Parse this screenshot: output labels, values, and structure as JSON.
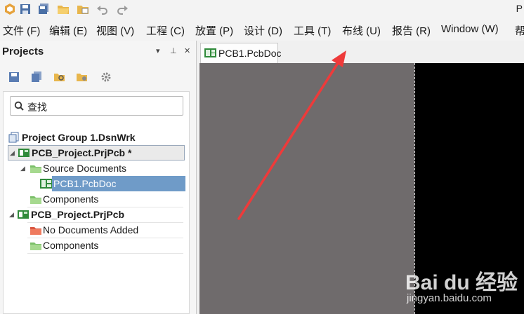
{
  "titlebar": {
    "title_fragment": "P",
    "quick_access": [
      "app-logo-icon",
      "save-icon",
      "save-all-icon",
      "open-folder-icon",
      "open-project-icon",
      "undo-icon",
      "redo-icon"
    ]
  },
  "menu": {
    "items": [
      "文件 (F)",
      "编辑 (E)",
      "视图 (V)",
      "工程 (C)",
      "放置 (P)",
      "设计 (D)",
      "工具 (T)",
      "布线 (U)",
      "报告 (R)",
      "Window (W)",
      "帮"
    ]
  },
  "projects_panel": {
    "title": "Projects",
    "header_buttons": [
      "▾",
      "⊥",
      "✕"
    ],
    "toolbar_icons": [
      "save-icon",
      "save-all-icon",
      "find-doc-icon",
      "project-settings-icon",
      "gear-icon"
    ],
    "search_text": "查找",
    "tree": [
      {
        "label": "Project Group 1.DsnWrk",
        "level": 0,
        "icon": "workspace-icon",
        "bold": true
      },
      {
        "label": "PCB_Project.PrjPcb *",
        "level": 0,
        "icon": "pcb-project-icon",
        "bold": true,
        "expanded": true,
        "outlined": true
      },
      {
        "label": "Source Documents",
        "level": 1,
        "icon": "folder-green-icon",
        "expanded": true
      },
      {
        "label": "PCB1.PcbDoc",
        "level": 2,
        "icon": "pcb-doc-icon",
        "selected": true
      },
      {
        "label": "Components",
        "level": 1,
        "icon": "folder-green-icon"
      },
      {
        "label": "PCB_Project.PrjPcb",
        "level": 0,
        "icon": "pcb-project-icon",
        "bold": true,
        "expanded": true
      },
      {
        "label": "No Documents Added",
        "level": 1,
        "icon": "folder-red-icon"
      },
      {
        "label": "Components",
        "level": 1,
        "icon": "folder-green-icon"
      }
    ]
  },
  "document": {
    "tab_label": "PCB1.PcbDoc"
  },
  "watermark": {
    "brand": "Bai du 经验",
    "site": "jingyan.baidu.com"
  },
  "colors": {
    "canvas_gray": "#6f6b6c",
    "board_black": "#000000",
    "selection": "#6f9bc8",
    "annotation_arrow": "#ee3a3a"
  }
}
